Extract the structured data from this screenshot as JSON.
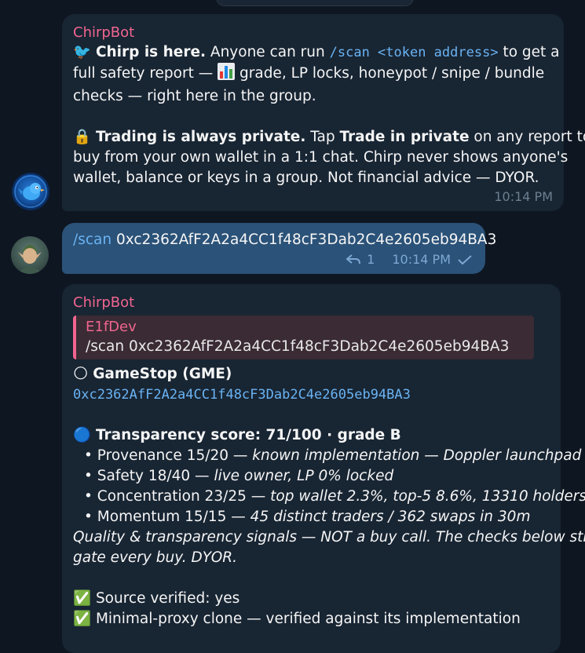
{
  "first_message": {
    "sender": "ChirpBot",
    "line1_emoji": "🐦",
    "line1_bold": "Chirp is here.",
    "line1_text": " Anyone can run ",
    "line1_cmd": "/scan <token address>",
    "line1_tail": " to get a",
    "line2_pre": "full safety report — ",
    "line2_emoji": "📊",
    "line2_post": " grade, LP locks, honeypot / snipe / bundle",
    "line3": "checks — right here in the group.",
    "line4_emoji": "🔒",
    "line4_bold1": "Trading is always private.",
    "line4_text1": " Tap ",
    "line4_bold2": "Trade in private",
    "line4_text2": " on any report to",
    "line5": "buy from your own wallet in a 1:1 chat. Chirp never shows anyone's",
    "line6": "wallet, balance or keys in a group. Not financial advice — DYOR.",
    "time": "10:14 PM"
  },
  "outgoing_message": {
    "cmd": "/scan",
    "address": " 0xc2362AfF2A2a4CC1f48cF3Dab2C4e2605eb94BA3",
    "reply_count": "1",
    "time": "10:14 PM"
  },
  "second_message": {
    "sender": "ChirpBot",
    "quote_author": "E1fDev",
    "quote_text": "/scan 0xc2362AfF2A2a4CC1f48cF3Dab2C4e2605eb94BA3",
    "token_emoji": "🌕",
    "token_name": "GameStop (GME)",
    "token_address": "0xc2362AfF2A2a4CC1f48cF3Dab2C4e2605eb94BA3",
    "score_emoji": "🔵",
    "score_title": "Transparency score: 71/100 · grade B",
    "bullets": [
      {
        "label": "• Provenance 15/20 — ",
        "detail": "known implementation — Doppler launchpad"
      },
      {
        "label": "• Safety 18/40 — ",
        "detail": "live owner, LP 0% locked"
      },
      {
        "label": "• Concentration 23/25 — ",
        "detail": "top wallet 2.3%, top-5 8.6%, 13310 holders"
      },
      {
        "label": "• Momentum 15/15 — ",
        "detail": "45 distinct traders / 362 swaps in 30m"
      }
    ],
    "disclaimer1": "Quality & transparency signals — NOT a buy call. The checks below still",
    "disclaimer2": "gate every buy. DYOR.",
    "check_emoji": "✅",
    "check1": "Source verified: yes",
    "check2": "Minimal-proxy clone — verified against its implementation"
  },
  "colors": {
    "background": "#0e1621",
    "incoming_bubble": "#182533",
    "outgoing_bubble": "#2b5278",
    "sender_name": "#f0658f",
    "link": "#6ab3f3",
    "timestamp": "#6d7f8f"
  }
}
